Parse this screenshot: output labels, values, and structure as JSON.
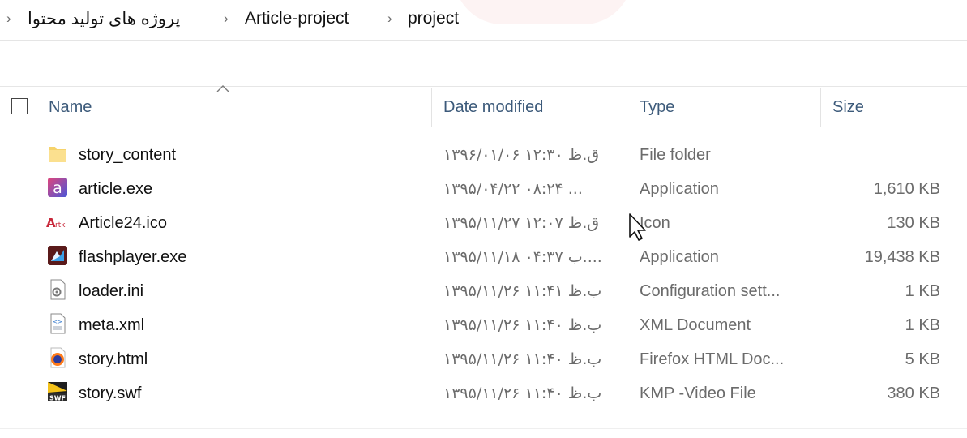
{
  "breadcrumb": {
    "items": [
      "پروژه های تولید محتوا",
      "Article-project",
      "project"
    ],
    "separator": "›"
  },
  "columns": {
    "name": "Name",
    "date": "Date modified",
    "type": "Type",
    "size": "Size"
  },
  "files": [
    {
      "name": "story_content",
      "date": "۱۳۹۶/۰۱/۰۶ ق.ظ ۱۲:۳۰",
      "type": "File folder",
      "size": "",
      "icon": "folder-icon"
    },
    {
      "name": "article.exe",
      "date": "۱۳۹۵/۰۴/۲۲ ۰۸:۲۴ ...",
      "type": "Application",
      "size": "1,610 KB",
      "icon": "article-app-icon"
    },
    {
      "name": "Article24.ico",
      "date": "۱۳۹۵/۱۱/۲۷ ق.ظ ۱۲:۰۷",
      "type": "Icon",
      "size": "130 KB",
      "icon": "article24-logo-icon"
    },
    {
      "name": "flashplayer.exe",
      "date": "۱۳۹۵/۱۱/۱۸ ب ۰۴:۳۷....",
      "type": "Application",
      "size": "19,438 KB",
      "icon": "flashplayer-icon"
    },
    {
      "name": "loader.ini",
      "date": "۱۳۹۵/۱۱/۲۶ ب.ظ ۱۱:۴۱",
      "type": "Configuration sett...",
      "size": "1 KB",
      "icon": "settings-file-icon"
    },
    {
      "name": "meta.xml",
      "date": "۱۳۹۵/۱۱/۲۶ ب.ظ ۱۱:۴۰",
      "type": "XML Document",
      "size": "1 KB",
      "icon": "xml-file-icon"
    },
    {
      "name": "story.html",
      "date": "۱۳۹۵/۱۱/۲۶ ب.ظ ۱۱:۴۰",
      "type": "Firefox HTML Doc...",
      "size": "5 KB",
      "icon": "firefox-icon"
    },
    {
      "name": "story.swf",
      "date": "۱۳۹۵/۱۱/۲۶ ب.ظ ۱۱:۴۰",
      "type": "KMP -Video File",
      "size": "380 KB",
      "icon": "swf-file-icon"
    }
  ]
}
